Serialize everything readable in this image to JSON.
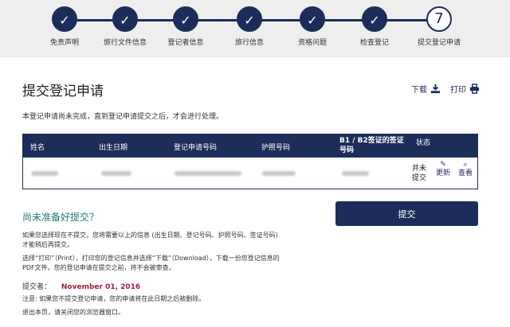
{
  "steps": [
    {
      "label": "免责声明",
      "icon": "check"
    },
    {
      "label": "旅行文件信息",
      "icon": "check"
    },
    {
      "label": "登记者信息",
      "icon": "check"
    },
    {
      "label": "旅行信息",
      "icon": "check"
    },
    {
      "label": "资格问题",
      "icon": "check"
    },
    {
      "label": "检查登记",
      "icon": "check"
    },
    {
      "label": "提交登记申请",
      "number": "7"
    }
  ],
  "check_glyph": "✓",
  "header": {
    "title": "提交登记申请",
    "download_label": "下载",
    "print_label": "打印"
  },
  "notice": "本登记申请尚未完成，直到登记申请提交之后，才会进行处理。",
  "table": {
    "headers": [
      "姓名",
      "出生日期",
      "登记申请号码",
      "护照号码",
      "B1 / B2签证的签证号码",
      "状态"
    ],
    "row": {
      "status": "并未提交",
      "update_label": "更新",
      "view_label": "查看"
    }
  },
  "not_ready": "尚未准备好提交？",
  "submit_label": "提交",
  "para1": "如果您选择现在不提交，您将需要以上的信息 (出生日期、登记号码、护照号码、签证号码) 才能稍后再提交。",
  "para2": "选择“打印”（Print），打印您的登记信息并选择“下载”（Download），下载一份您登记信息的PDF文件。您的登记申请在提交之前，将不会被审查。",
  "submitter_label": "提交者：",
  "submit_date": "November 01, 2016",
  "para3": "注意: 如果您不提交登记申请，您的申请将在此日期之后被删除。",
  "para4": "退出本页，请关闭您的浏览器窗口。",
  "colors": {
    "primary": "#1c2d5a",
    "accent_teal": "#1f7a7a",
    "date_red": "#a0203a"
  }
}
